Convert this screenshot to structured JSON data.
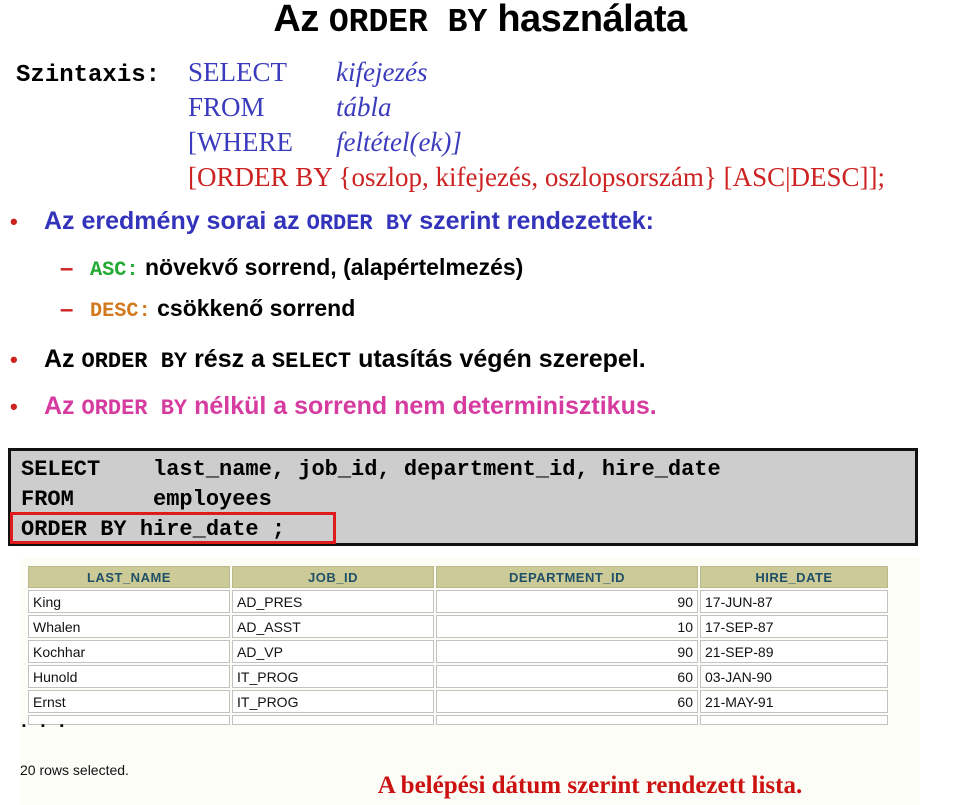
{
  "title": {
    "part1": "Az ",
    "mono": "ORDER BY",
    "part2": " használata"
  },
  "syntax": {
    "label": "Szintaxis:",
    "lines": [
      {
        "keyword": "SELECT",
        "value": "kifejezés"
      },
      {
        "keyword": "FROM",
        "value": "tábla"
      },
      {
        "keyword": "[WHERE",
        "value": "feltétel(ek)]"
      }
    ],
    "order_line": {
      "prefix": "[ORDER BY {",
      "italic": "oszlop, kifejezés, oszlopsorszám",
      "suffix": "} [ASC|DESC]];"
    }
  },
  "bullets": {
    "b1": {
      "marker": "•",
      "pre": "Az eredmény sorai az ",
      "mono": "ORDER BY",
      "post": " szerint rendezettek:"
    },
    "b2": {
      "marker": "–",
      "mono": "ASC:",
      "text": " növekvő sorrend, (alapértelmezés)"
    },
    "b3": {
      "marker": "–",
      "mono": "DESC:",
      "text": " csökkenő sorrend"
    },
    "b4": {
      "marker": "•",
      "pre": "Az ",
      "mono1": "ORDER BY",
      "mid": " rész a ",
      "mono2": "SELECT",
      "post": " utasítás végén szerepel."
    },
    "b5": {
      "marker": "•",
      "pre": "Az ",
      "mono": "ORDER BY",
      "post": "  nélkül a sorrend  nem determinisztikus."
    }
  },
  "code": {
    "line1": "SELECT    last_name, job_id, department_id, hire_date",
    "line2": "FROM      employees",
    "line3": "ORDER BY hire_date ;"
  },
  "result": {
    "headers": [
      "LAST_NAME",
      "JOB_ID",
      "DEPARTMENT_ID",
      "HIRE_DATE"
    ],
    "rows": [
      {
        "last_name": "King",
        "job_id": "AD_PRES",
        "department_id": "90",
        "hire_date": "17-JUN-87"
      },
      {
        "last_name": "Whalen",
        "job_id": "AD_ASST",
        "department_id": "10",
        "hire_date": "17-SEP-87"
      },
      {
        "last_name": "Kochhar",
        "job_id": "AD_VP",
        "department_id": "90",
        "hire_date": "21-SEP-89"
      },
      {
        "last_name": "Hunold",
        "job_id": "IT_PROG",
        "department_id": "60",
        "hire_date": "03-JAN-90"
      },
      {
        "last_name": "Ernst",
        "job_id": "IT_PROG",
        "department_id": "60",
        "hire_date": "21-MAY-91"
      }
    ],
    "ellipsis": "▪ ▪ ▪",
    "rows_selected": "20 rows selected."
  },
  "caption": "A belépési dátum szerint rendezett lista.",
  "colors": {
    "blue": "#3333bb",
    "red": "#cc2222",
    "pink": "#d63ba0",
    "green": "#22aa33",
    "orange": "#d2791e",
    "syntax_blue": "#3b3bbd",
    "header_bg": "#ccca96",
    "header_text": "#1f5068",
    "code_bg": "#cdcdcd",
    "highlight_red": "#e01b1b"
  }
}
